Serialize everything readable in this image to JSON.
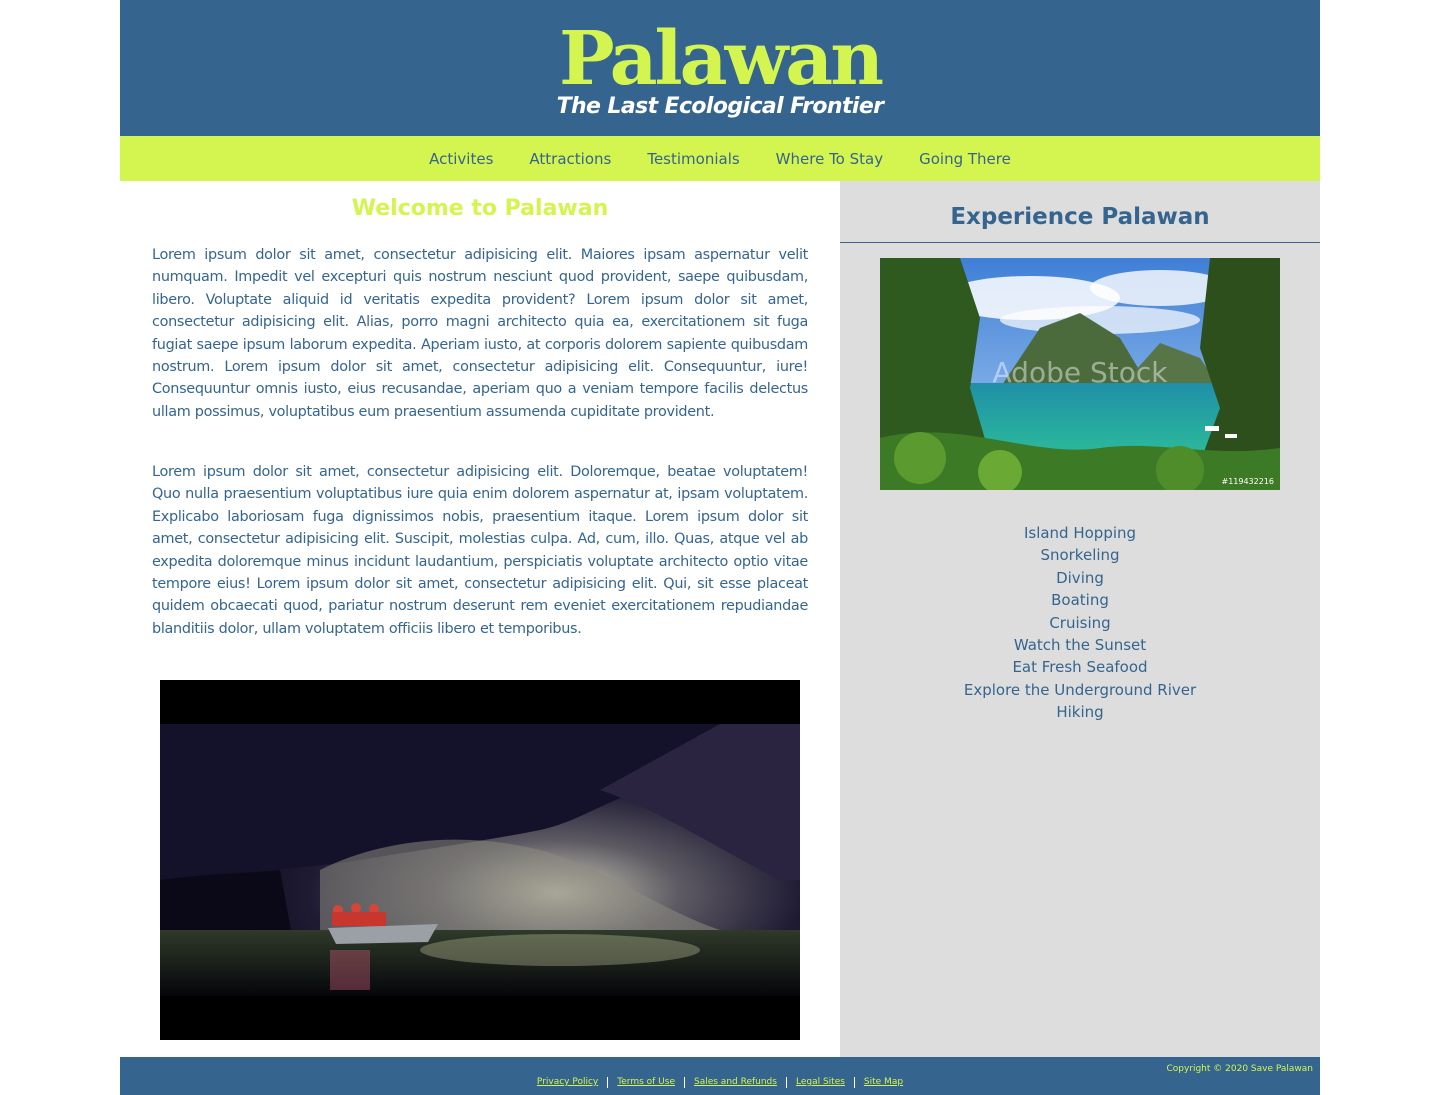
{
  "header": {
    "title": "Palawan",
    "tagline": "The Last Ecological Frontier"
  },
  "nav": {
    "items": [
      "Activites",
      "Attractions",
      "Testimonials",
      "Where To Stay",
      "Going There"
    ]
  },
  "main": {
    "title": "Welcome to Palawan",
    "paragraphs": [
      "Lorem ipsum dolor sit amet, consectetur adipisicing elit. Maiores ipsam aspernatur velit numquam. Impedit vel excepturi quis nostrum nesciunt quod provident, saepe quibusdam, libero. Voluptate aliquid id veritatis expedita provident? Lorem ipsum dolor sit amet, consectetur adipisicing elit. Alias, porro magni architecto quia ea, exercitationem sit fuga fugiat saepe ipsum laborum expedita. Aperiam iusto, at corporis dolorem sapiente quibusdam nostrum. Lorem ipsum dolor sit amet, consectetur adipisicing elit. Consequuntur, iure! Consequuntur omnis iusto, eius recusandae, aperiam quo a veniam tempore facilis delectus ullam possimus, voluptatibus eum praesentium assumenda cupiditate provident.",
      "Lorem ipsum dolor sit amet, consectetur adipisicing elit. Doloremque, beatae voluptatem! Quo nulla praesentium voluptatibus iure quia enim dolorem aspernatur at, ipsam voluptatem. Explicabo laboriosam fuga dignissimos nobis, praesentium itaque. Lorem ipsum dolor sit amet, consectetur adipisicing elit. Suscipit, molestias culpa. Ad, cum, illo. Quas, atque vel ab expedita doloremque minus incidunt laudantium, perspiciatis voluptate architecto optio vitae tempore eius! Lorem ipsum dolor sit amet, consectetur adipisicing elit. Qui, sit esse placeat quidem obcaecati quod, pariatur nostrum deserunt rem eveniet exercitationem repudiandae blanditiis dolor, ullam voluptatem officiis libero et temporibus."
    ]
  },
  "sidebar": {
    "title": "Experience Palawan",
    "photo_watermark": "Adobe Stock",
    "photo_id": "#119432216",
    "activities": [
      "Island Hopping",
      "Snorkeling",
      "Diving",
      "Boating",
      "Cruising",
      "Watch the Sunset",
      "Eat Fresh Seafood",
      "Explore the Underground River",
      "Hiking"
    ]
  },
  "footer": {
    "copyright": "Copyright © 2020 Save Palawan",
    "links": [
      "Privacy Policy",
      "Terms of Use",
      "Sales and Refunds",
      "Legal Sites",
      "Site Map"
    ]
  },
  "colors": {
    "primary_blue": "#35658e",
    "accent_lime": "#d4f54f",
    "sidebar_gray": "#dddddd"
  }
}
